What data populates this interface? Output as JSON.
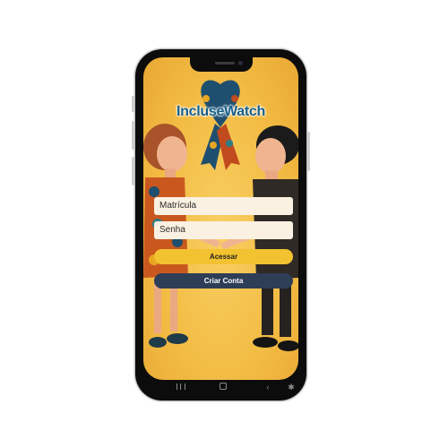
{
  "app": {
    "title": "IncluseWatch"
  },
  "form": {
    "matricula_placeholder": "Matrícula",
    "senha_placeholder": "Senha"
  },
  "buttons": {
    "acessar_label": "Acessar",
    "criar_conta_label": "Criar Conta"
  },
  "navbar": {
    "icons": [
      "recent-apps-icon",
      "home-icon",
      "back-icon",
      "accessibility-icon"
    ]
  },
  "colors": {
    "background": "#f3bd45",
    "title": "#17608a",
    "primary_button": "#f3c230",
    "secondary_button": "#2e3e57",
    "field": "#fbf1e2"
  }
}
